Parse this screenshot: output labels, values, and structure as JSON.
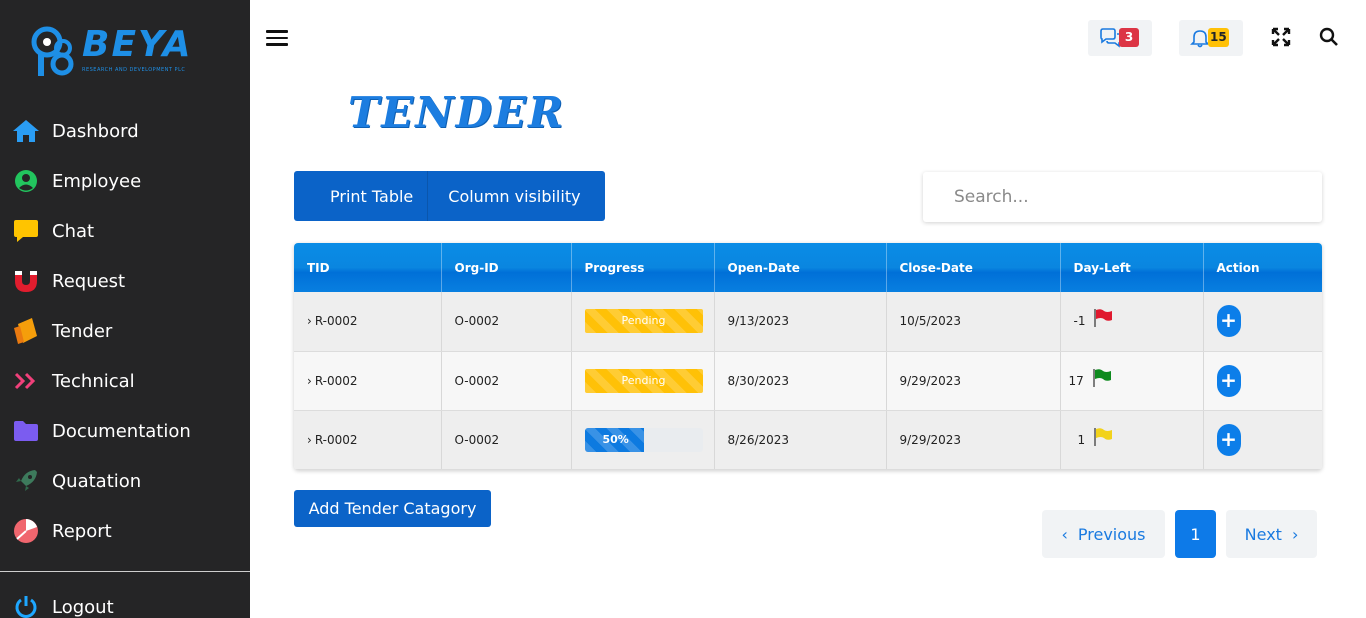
{
  "brand": {
    "name": "BEYA",
    "tagline": "RESEARCH AND DEVELOPMENT PLC"
  },
  "sidebar": {
    "items": [
      {
        "label": "Dashbord",
        "icon": "home-icon"
      },
      {
        "label": "Employee",
        "icon": "user-circle-icon"
      },
      {
        "label": "Chat",
        "icon": "chat-bubble-icon"
      },
      {
        "label": "Request",
        "icon": "magnet-icon"
      },
      {
        "label": "Tender",
        "icon": "tender-icon"
      },
      {
        "label": "Technical",
        "icon": "double-chevron-icon"
      },
      {
        "label": "Documentation",
        "icon": "folder-icon"
      },
      {
        "label": "Quatation",
        "icon": "rocket-icon"
      },
      {
        "label": "Report",
        "icon": "pie-chart-icon"
      }
    ],
    "logout": "Logout"
  },
  "header": {
    "messages_count": "3",
    "notifications_count": "15"
  },
  "page": {
    "title": "TENDER"
  },
  "toolbar": {
    "print_label": "Print Table",
    "column_visibility_label": "Column visibility"
  },
  "search": {
    "placeholder": "Search..."
  },
  "table": {
    "headers": [
      "TID",
      "Org-ID",
      "Progress",
      "Open-Date",
      "Close-Date",
      "Day-Left",
      "Action"
    ],
    "rows": [
      {
        "tid": "R-0002",
        "org": "O-0002",
        "progress": "Pending",
        "open": "9/13/2023",
        "close": "10/5/2023",
        "day_left": "-1",
        "flag": "red",
        "action": "+"
      },
      {
        "tid": "R-0002",
        "org": "O-0002",
        "progress": "Pending",
        "open": "8/30/2023",
        "close": "9/29/2023",
        "day_left": "17",
        "flag": "green",
        "action": "+"
      },
      {
        "tid": "R-0002",
        "org": "O-0002",
        "progress": "50%",
        "progress_value": 0.5,
        "open": "8/26/2023",
        "close": "9/29/2023",
        "day_left": "1",
        "flag": "yellow",
        "action": "+"
      }
    ]
  },
  "colors": {
    "accent": "#0b63c8",
    "flag_red": "#e0182e",
    "flag_green": "#0e8a1e",
    "flag_yellow": "#f2d21b",
    "pending": "#ffc107"
  },
  "add_button": "Add Tender Catagory",
  "pagination": {
    "previous": "Previous",
    "current": "1",
    "next": "Next"
  }
}
